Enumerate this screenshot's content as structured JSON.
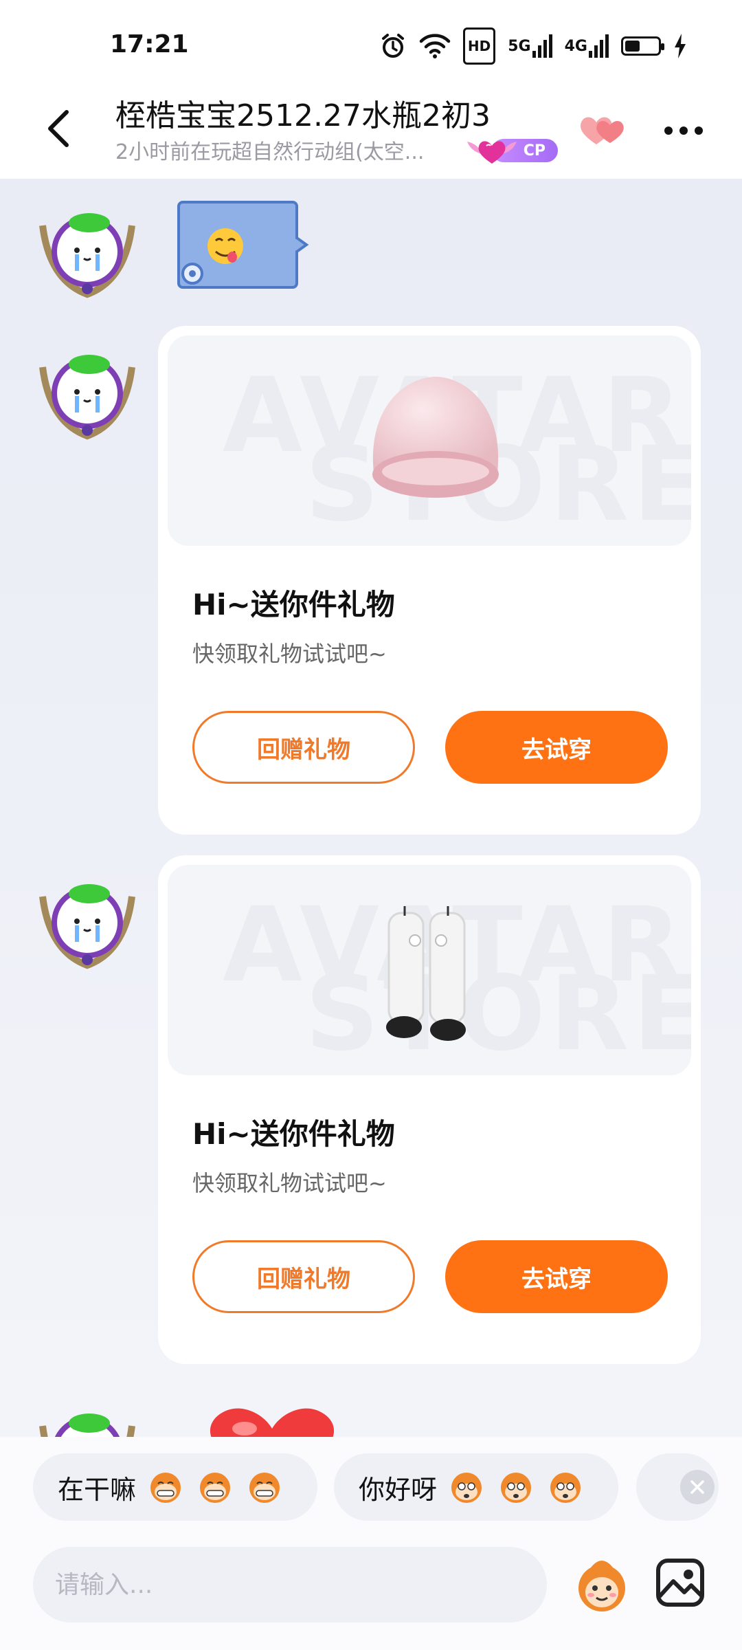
{
  "status_bar": {
    "time": "17:21",
    "hd_label": "HD",
    "net1": "5G",
    "net2": "4G",
    "battery_level": 0.45
  },
  "header": {
    "title": "桎梏宝宝2512.27水瓶2初3",
    "subtitle": "2小时前在玩超自然行动组(太空...",
    "cp_label": "CP",
    "icons": [
      "back-arrow-icon",
      "hearts-icon",
      "more-icon"
    ]
  },
  "messages": [
    {
      "type": "sticker",
      "emoji": "😋"
    },
    {
      "type": "gift",
      "item": "hat",
      "watermark_line1": "AVATAR",
      "watermark_line2": "STORE",
      "title": "Hi~送你件礼物",
      "desc": "快领取礼物试试吧~",
      "return_label": "回赠礼物",
      "try_label": "去试穿"
    },
    {
      "type": "gift",
      "item": "boots",
      "watermark_line1": "AVATAR",
      "watermark_line2": "STORE",
      "title": "Hi~送你件礼物",
      "desc": "快领取礼物试试吧~",
      "return_label": "回赠礼物",
      "try_label": "去试穿"
    },
    {
      "type": "sticker",
      "emoji": "heart"
    }
  ],
  "quick_replies": [
    {
      "text": "在干嘛"
    },
    {
      "text": "你好呀"
    }
  ],
  "input": {
    "placeholder": "请输入..."
  },
  "colors": {
    "accent": "#ff7214",
    "accent_outline": "#f07a2a",
    "purple": "#a46bf5"
  }
}
